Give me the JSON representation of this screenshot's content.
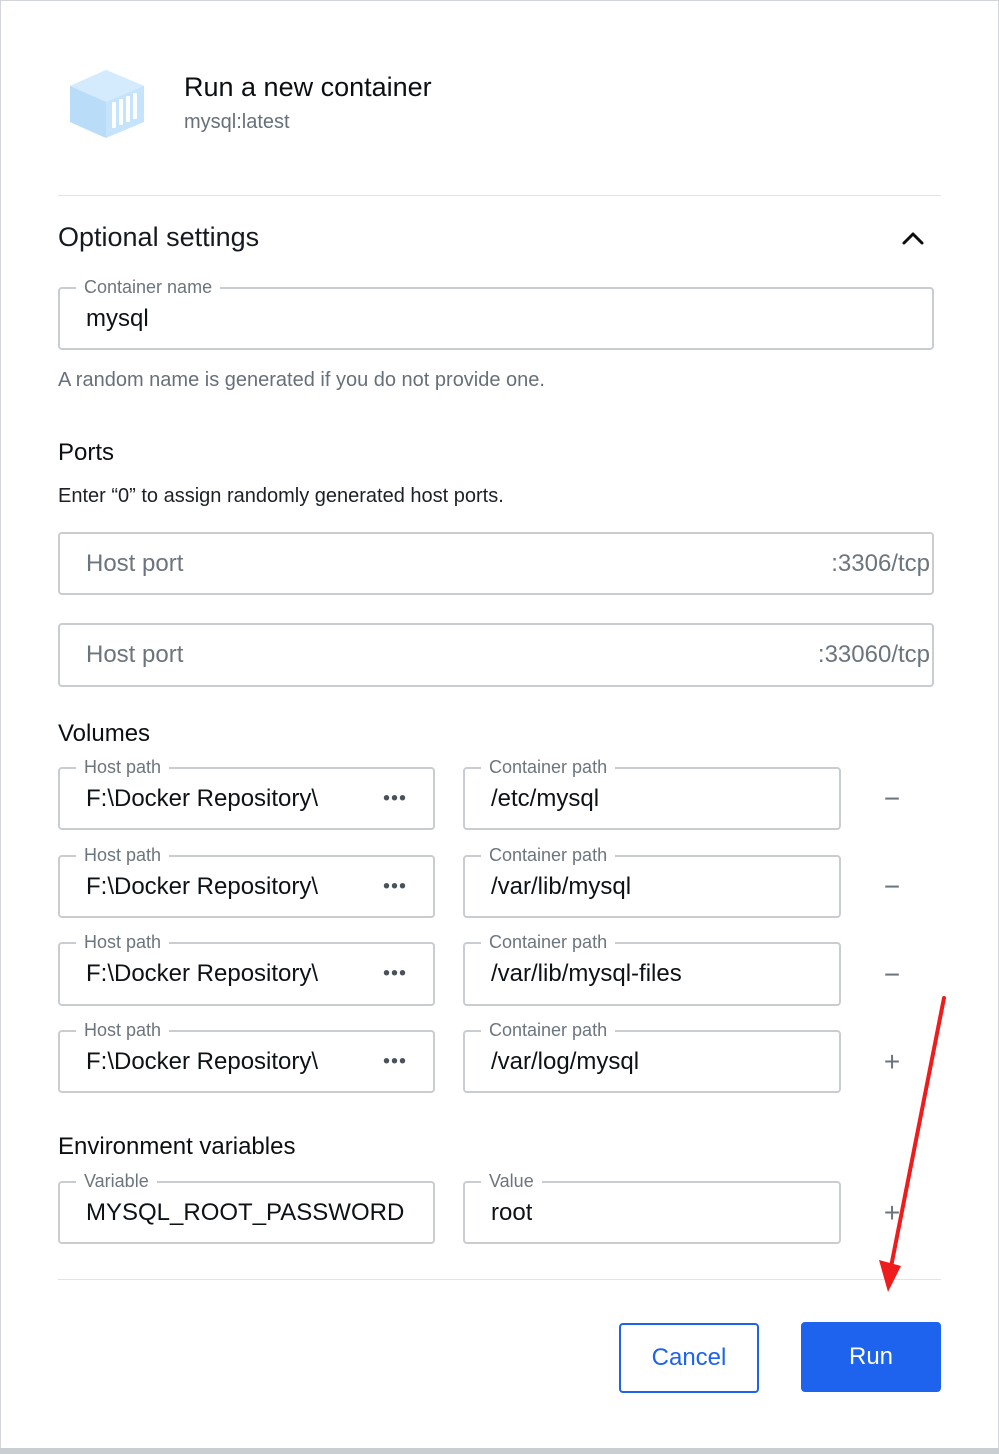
{
  "header": {
    "title": "Run a new container",
    "image": "mysql:latest",
    "logo_icon": "container-icon",
    "logo_color": "#c5e3fb"
  },
  "optional_settings": {
    "heading": "Optional settings",
    "toggle_icon": "chevron-up-icon",
    "container_name": {
      "label": "Container name",
      "value": "mysql",
      "helper": "A random name is generated if you do not provide one."
    }
  },
  "ports": {
    "heading": "Ports",
    "description": "Enter “0” to assign randomly generated host ports.",
    "items": [
      {
        "placeholder": "Host port",
        "container_port": ":3306/tcp"
      },
      {
        "placeholder": "Host port",
        "container_port": ":33060/tcp"
      }
    ]
  },
  "volumes": {
    "heading": "Volumes",
    "host_label": "Host path",
    "container_label": "Container path",
    "browse_icon": "more-horizontal-icon",
    "items": [
      {
        "host": "F:\\Docker Repository\\",
        "container": "/etc/mysql",
        "action": "−",
        "action_icon": "minus-icon"
      },
      {
        "host": "F:\\Docker Repository\\",
        "container": "/var/lib/mysql",
        "action": "−",
        "action_icon": "minus-icon"
      },
      {
        "host": "F:\\Docker Repository\\",
        "container": "/var/lib/mysql-files",
        "action": "−",
        "action_icon": "minus-icon"
      },
      {
        "host": "F:\\Docker Repository\\",
        "container": "/var/log/mysql",
        "action": "+",
        "action_icon": "plus-icon"
      }
    ]
  },
  "env": {
    "heading": "Environment variables",
    "variable_label": "Variable",
    "value_label": "Value",
    "items": [
      {
        "variable": "MYSQL_ROOT_PASSWORD",
        "value": "root",
        "action": "+",
        "action_icon": "plus-icon"
      }
    ]
  },
  "footer": {
    "cancel": "Cancel",
    "run": "Run"
  },
  "colors": {
    "primary": "#1d63ed",
    "annotation_arrow": "#ee1c1c"
  }
}
